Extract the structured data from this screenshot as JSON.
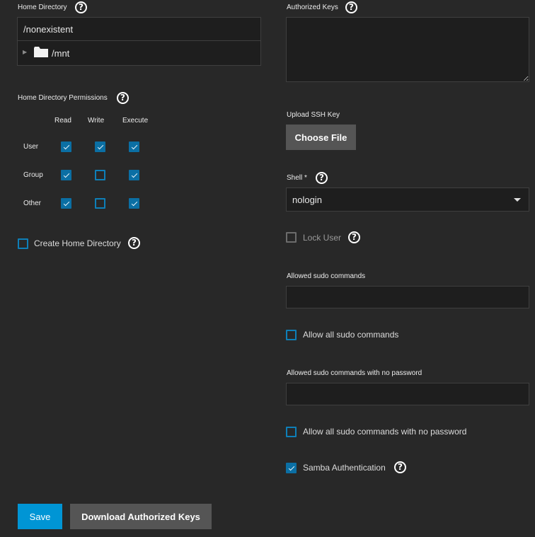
{
  "home_directory": {
    "label": "Home Directory",
    "value": "/nonexistent",
    "tree_item": "/mnt"
  },
  "permissions": {
    "label": "Home Directory Permissions",
    "columns": [
      "Read",
      "Write",
      "Execute"
    ],
    "rows": [
      {
        "label": "User",
        "read": true,
        "write": true,
        "execute": true
      },
      {
        "label": "Group",
        "read": true,
        "write": false,
        "execute": true
      },
      {
        "label": "Other",
        "read": true,
        "write": false,
        "execute": true
      }
    ]
  },
  "create_home": {
    "label": "Create Home Directory",
    "checked": false
  },
  "authorized_keys": {
    "label": "Authorized Keys",
    "value": ""
  },
  "upload_ssh": {
    "label": "Upload SSH Key",
    "button": "Choose File"
  },
  "shell": {
    "label": "Shell",
    "required_mark": "*",
    "value": "nologin"
  },
  "lock_user": {
    "label": "Lock User",
    "checked": false
  },
  "sudo": {
    "label": "Allowed sudo commands",
    "value": ""
  },
  "allow_all_sudo": {
    "label": "Allow all sudo commands",
    "checked": false
  },
  "sudo_nopass": {
    "label": "Allowed sudo commands with no password",
    "value": ""
  },
  "allow_all_sudo_nopass": {
    "label": "Allow all sudo commands with no password",
    "checked": false
  },
  "samba": {
    "label": "Samba Authentication",
    "checked": true
  },
  "actions": {
    "save": "Save",
    "download": "Download Authorized Keys"
  },
  "colors": {
    "primary": "#0095d5",
    "background": "#282828",
    "field": "#1e1e1e",
    "checkbox": "#0b6fa4"
  }
}
